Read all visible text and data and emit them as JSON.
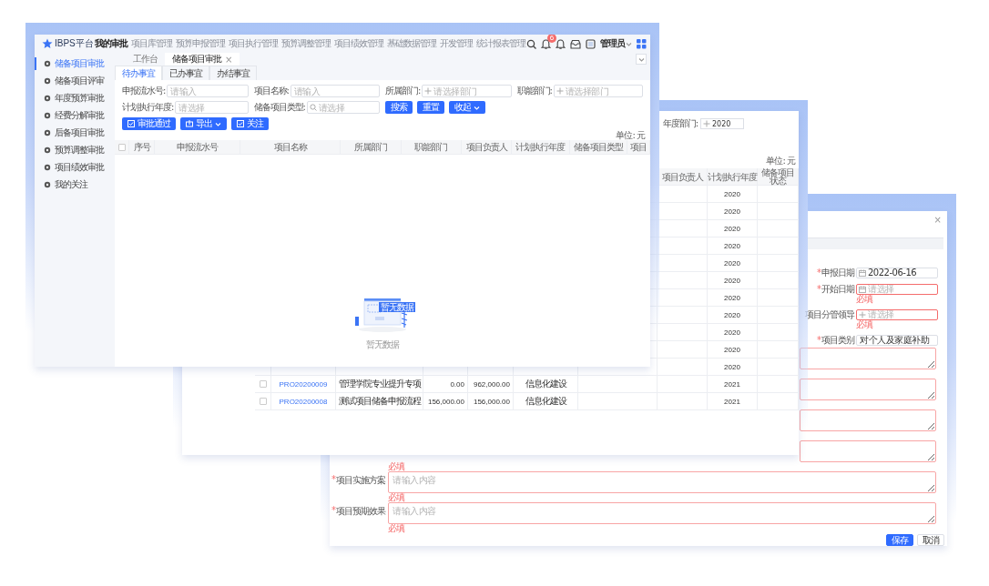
{
  "main_window": {
    "logo": "IBPS平台",
    "nav": [
      {
        "label": "我的审批",
        "selected": true
      },
      {
        "label": "项目库管理",
        "selected": false
      },
      {
        "label": "预算申报管理",
        "selected": false
      },
      {
        "label": "项目执行管理",
        "selected": false
      },
      {
        "label": "预算调整管理",
        "selected": false
      },
      {
        "label": "项目绩效管理",
        "selected": false
      },
      {
        "label": "基础数据管理",
        "selected": false
      },
      {
        "label": "开发管理",
        "selected": false
      },
      {
        "label": "统计报表管理",
        "selected": false
      }
    ],
    "badge": "6",
    "user": "管理员",
    "page_tabs": [
      {
        "label": "工作台",
        "selected": false
      },
      {
        "label": "储备项目审批",
        "selected": true,
        "close": "×"
      }
    ],
    "sidebar": [
      {
        "label": "储备项目审批",
        "selected": true
      },
      {
        "label": "储备项目评审",
        "selected": false
      },
      {
        "label": "年度预算审批",
        "selected": false
      },
      {
        "label": "经费分解审批",
        "selected": false
      },
      {
        "label": "后备项目审批",
        "selected": false
      },
      {
        "label": "预算调整审批",
        "selected": false
      },
      {
        "label": "项目绩效审批",
        "selected": false
      },
      {
        "label": "我的关注",
        "selected": false
      }
    ],
    "sub_tabs": [
      {
        "label": "待办事宜",
        "selected": true
      },
      {
        "label": "已办事宜",
        "selected": false
      },
      {
        "label": "办结事宜",
        "selected": false
      }
    ],
    "filters": [
      {
        "label": "申报流水号:",
        "placeholder": "请输入",
        "kind": "text"
      },
      {
        "label": "项目名称:",
        "placeholder": "请输入",
        "kind": "text"
      },
      {
        "label": "所属部门:",
        "placeholder": "请选择部门",
        "kind": "picker"
      },
      {
        "label": "职能部门:",
        "placeholder": "请选择部门",
        "kind": "picker"
      },
      {
        "label": "计划执行年度:",
        "placeholder": "请选择",
        "kind": "text"
      },
      {
        "label": "储备项目类型:",
        "placeholder": "请选择",
        "kind": "search"
      }
    ],
    "filter_buttons": [
      {
        "label": "搜索",
        "dropdown": false
      },
      {
        "label": "重置",
        "dropdown": false
      },
      {
        "label": "收起",
        "dropdown": true
      }
    ],
    "action_buttons": [
      {
        "label": "审批通过",
        "dropdown": false
      },
      {
        "label": "导出",
        "dropdown": true
      },
      {
        "label": "关注",
        "dropdown": false
      }
    ],
    "unit": "单位: 元",
    "table": {
      "header_checked": false,
      "columns": [
        "序号",
        "申报流水号",
        "项目名称",
        "所属部门",
        "职能部门",
        "项目负责人",
        "计划执行年度",
        "储备项目类型",
        "项目"
      ]
    },
    "empty": {
      "tag": "暂无数据",
      "caption": "暂无数据"
    }
  },
  "list_window": {
    "year_filter": {
      "label": "年度部门:",
      "value": "2020"
    },
    "unit": "单位: 元",
    "columns": [
      "项目负责人",
      "计划执行年度",
      "储备项目状态"
    ],
    "rows": [
      {
        "year": "2020"
      },
      {
        "year": "2020"
      },
      {
        "year": "2020"
      },
      {
        "year": "2020"
      },
      {
        "year": "2020"
      },
      {
        "year": "2020"
      },
      {
        "year": "2020"
      },
      {
        "year": "2020"
      },
      {
        "year": "2020"
      },
      {
        "year": "2020"
      },
      {
        "year": "2020"
      },
      {
        "checked": false,
        "code": "PRO20200009",
        "name": "管理学院专业提升专项",
        "amount_1": "0.00",
        "amount_2": "962,000.00",
        "type": "信息化建设",
        "year": "2021"
      },
      {
        "checked": false,
        "code": "PRO20200008",
        "name": "测试项目储备申报流程",
        "amount_1": "156,000.00",
        "amount_2": "156,000.00",
        "type": "信息化建设",
        "year": "2021"
      }
    ]
  },
  "form_window": {
    "close": "×",
    "required_mark": "*",
    "fields": [
      {
        "label": "申报日期",
        "required": true,
        "kind": "date",
        "value": "2022-06-16",
        "invalid": false
      },
      {
        "label": "开始日期",
        "required": true,
        "kind": "date",
        "placeholder": "请选择",
        "invalid": true,
        "error": "必填"
      },
      {
        "label": "项目分管领导",
        "required": false,
        "kind": "picker",
        "placeholder": "请选择",
        "invalid": true,
        "error": "必填"
      },
      {
        "label": "项目类别",
        "required": true,
        "kind": "text",
        "value": "对个人及家庭补助",
        "invalid": false
      }
    ],
    "text_areas": [
      {
        "invalid": true
      },
      {
        "invalid": true
      },
      {
        "invalid": true
      },
      {
        "invalid": true,
        "error": "必填"
      },
      {
        "label": "项目实施方案",
        "required": true,
        "placeholder": "请输入内容",
        "invalid": true,
        "error": "必填"
      },
      {
        "label": "项目预期效果",
        "required": true,
        "placeholder": "请输入内容",
        "invalid": true,
        "error": "必填"
      }
    ],
    "buttons": [
      {
        "label": "保存",
        "kind": "primary"
      },
      {
        "label": "取消",
        "kind": "plain"
      }
    ]
  }
}
